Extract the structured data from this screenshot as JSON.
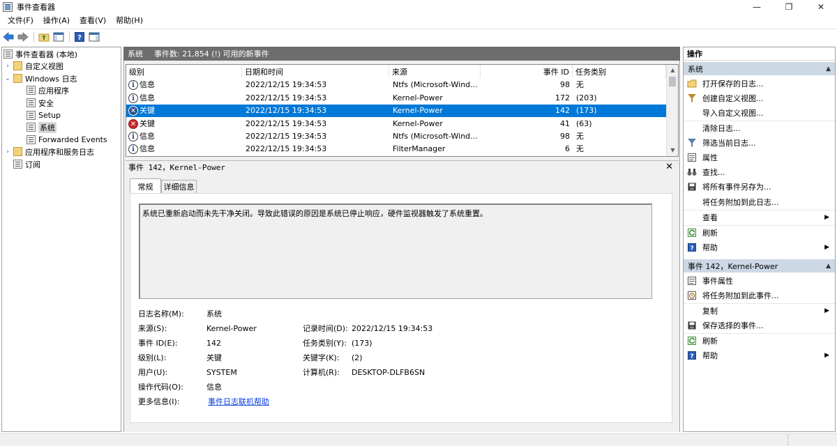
{
  "window": {
    "title": "事件查看器",
    "minimize": "—",
    "maximize": "❐",
    "close": "✕"
  },
  "menu": [
    "文件(F)",
    "操作(A)",
    "查看(V)",
    "帮助(H)"
  ],
  "tree": {
    "root": "事件查看器 (本地)",
    "custom_views": "自定义视图",
    "windows_logs": "Windows 日志",
    "application": "应用程序",
    "security": "安全",
    "setup": "Setup",
    "system": "系统",
    "forwarded": "Forwarded Events",
    "app_service_logs": "应用程序和服务日志",
    "subscriptions": "订阅"
  },
  "center_header": {
    "log_name": "系统",
    "count_text": "事件数: 21,854 (!) 可用的新事件"
  },
  "event_list": {
    "columns": {
      "level": "级别",
      "datetime": "日期和时间",
      "source": "来源",
      "event_id": "事件 ID",
      "task": "任务类别"
    },
    "rows": [
      {
        "level": "信息",
        "datetime": "2022/12/15 19:34:53",
        "source": "Ntfs (Microsoft-Wind...",
        "event_id": "98",
        "task": "无"
      },
      {
        "level": "信息",
        "datetime": "2022/12/15 19:34:53",
        "source": "Kernel-Power",
        "event_id": "172",
        "task": "(203)"
      },
      {
        "level": "关键",
        "datetime": "2022/12/15 19:34:53",
        "source": "Kernel-Power",
        "event_id": "142",
        "task": "(173)"
      },
      {
        "level": "关键",
        "datetime": "2022/12/15 19:34:53",
        "source": "Kernel-Power",
        "event_id": "41",
        "task": "(63)"
      },
      {
        "level": "信息",
        "datetime": "2022/12/15 19:34:53",
        "source": "Ntfs (Microsoft-Wind...",
        "event_id": "98",
        "task": "无"
      },
      {
        "level": "信息",
        "datetime": "2022/12/15 19:34:53",
        "source": "FilterManager",
        "event_id": "6",
        "task": "无"
      }
    ]
  },
  "detail": {
    "header": "事件 142，Kernel-Power",
    "close": "✕",
    "tab_general": "常规",
    "tab_details": "详细信息",
    "description": "系统已重新启动而未先干净关闭。导致此错误的原因是系统已停止响应，硬件监视器触发了系统重置。",
    "labels": {
      "log_name": "日志名称(M):",
      "source": "来源(S):",
      "event_id": "事件 ID(E):",
      "level": "级别(L):",
      "user": "用户(U):",
      "opcode": "操作代码(O):",
      "more_info": "更多信息(I):",
      "logged": "记录时间(D):",
      "task_category": "任务类别(Y):",
      "keywords": "关键字(K):",
      "computer": "计算机(R):"
    },
    "values": {
      "log_name": "系统",
      "source": "Kernel-Power",
      "event_id": "142",
      "level": "关键",
      "user": "SYSTEM",
      "opcode": "信息",
      "more_info_link": "事件日志联机帮助",
      "logged": "2022/12/15 19:34:53",
      "task_category": "(173)",
      "keywords": "(2)",
      "computer": "DESKTOP-DLFB6SN"
    }
  },
  "actions": {
    "title": "操作",
    "section1": "系统",
    "section1_items": [
      "打开保存的日志...",
      "创建自定义视图...",
      "导入自定义视图...",
      "清除日志...",
      "筛选当前日志...",
      "属性",
      "查找...",
      "将所有事件另存为...",
      "将任务附加到此日志...",
      "查看",
      "刷新",
      "帮助"
    ],
    "section2": "事件 142，Kernel-Power",
    "section2_items": [
      "事件属性",
      "将任务附加到此事件...",
      "复制",
      "保存选择的事件...",
      "刷新",
      "帮助"
    ]
  },
  "colors": {
    "selection": "#0078d7",
    "header_bar": "#6d6d6d",
    "section_bg": "#cdd8e5",
    "link": "#0b3fdc",
    "critical": "#c62828"
  }
}
